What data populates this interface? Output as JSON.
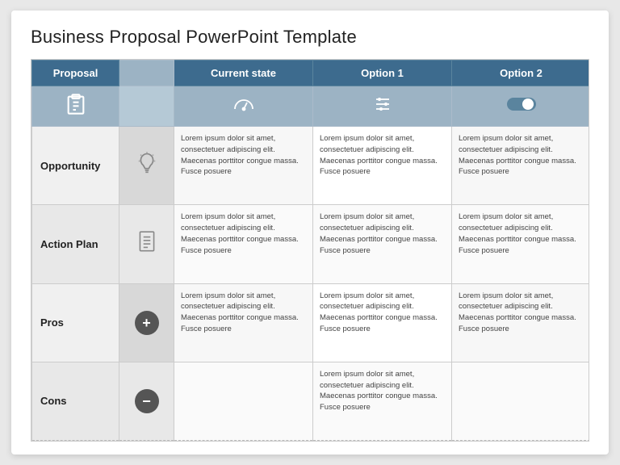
{
  "slide": {
    "title": "Business Proposal PowerPoint Template",
    "header": {
      "proposal_label": "Proposal",
      "current_label": "Current state",
      "option1_label": "Option 1",
      "option2_label": "Option 2"
    },
    "lorem": "Lorem ipsum dolor sit amet, consectetuer adipiscing elit. Maecenas porttitor congue massa. Fusce posuere",
    "rows": [
      {
        "label": "Opportunity",
        "icon_type": "bulb",
        "has_current": true,
        "has_opt1": true,
        "has_opt2": true
      },
      {
        "label": "Action Plan",
        "icon_type": "list",
        "has_current": true,
        "has_opt1": true,
        "has_opt2": true
      },
      {
        "label": "Pros",
        "icon_type": "plus",
        "has_current": true,
        "has_opt1": true,
        "has_opt2": true
      },
      {
        "label": "Cons",
        "icon_type": "minus",
        "has_current": false,
        "has_opt1": true,
        "has_opt2": false
      }
    ]
  }
}
